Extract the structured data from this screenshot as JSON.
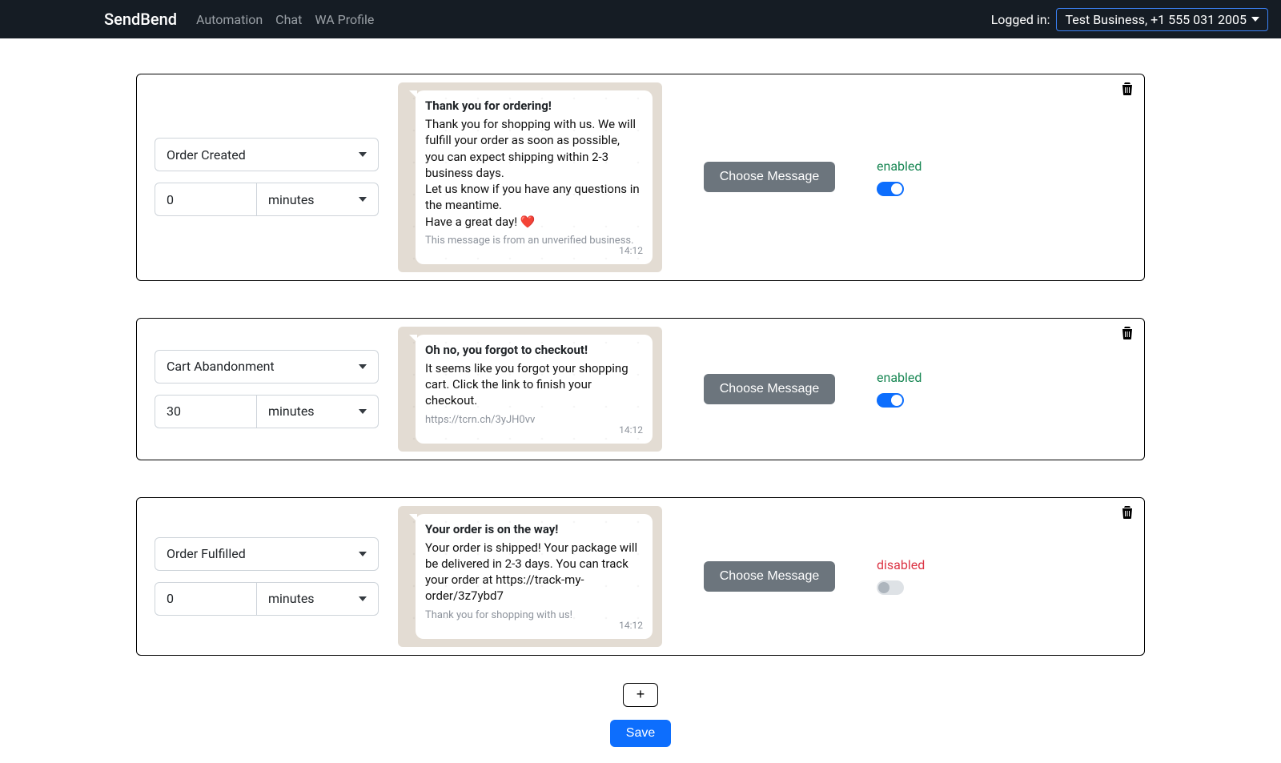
{
  "navbar": {
    "brand": "SendBend",
    "links": [
      "Automation",
      "Chat",
      "WA Profile"
    ],
    "logged_in_label": "Logged in:",
    "account": "Test Business, +1 555 031 2005"
  },
  "rules": [
    {
      "trigger": "Order Created",
      "delay_value": "0",
      "delay_unit": "minutes",
      "message": {
        "title": "Thank you for ordering!",
        "body": "Thank you for shopping with us. We will fulfill your order as soon as possible,\nyou can expect shipping within 2-3 business days.\nLet us know if you have any questions in the meantime.\nHave a great day! ❤️",
        "footer": "This message is from an unverified business.",
        "time": "14:12"
      },
      "choose_label": "Choose Message",
      "status_label": "enabled",
      "enabled": true
    },
    {
      "trigger": "Cart Abandonment",
      "delay_value": "30",
      "delay_unit": "minutes",
      "message": {
        "title": "Oh no, you forgot to checkout!",
        "body": "It seems like you forgot your shopping cart. Click the link to finish your checkout.",
        "footer": "https://tcrn.ch/3yJH0vv",
        "time": "14:12"
      },
      "choose_label": "Choose Message",
      "status_label": "enabled",
      "enabled": true
    },
    {
      "trigger": "Order Fulfilled",
      "delay_value": "0",
      "delay_unit": "minutes",
      "message": {
        "title": "Your order is on the way!",
        "body": "Your order is shipped! Your package will be delivered in 2-3 days. You can track your order at https://track-my-order/3z7ybd7",
        "footer": "Thank you for shopping with us!",
        "time": "14:12"
      },
      "choose_label": "Choose Message",
      "status_label": "disabled",
      "enabled": false
    }
  ],
  "buttons": {
    "add": "+",
    "save": "Save"
  }
}
